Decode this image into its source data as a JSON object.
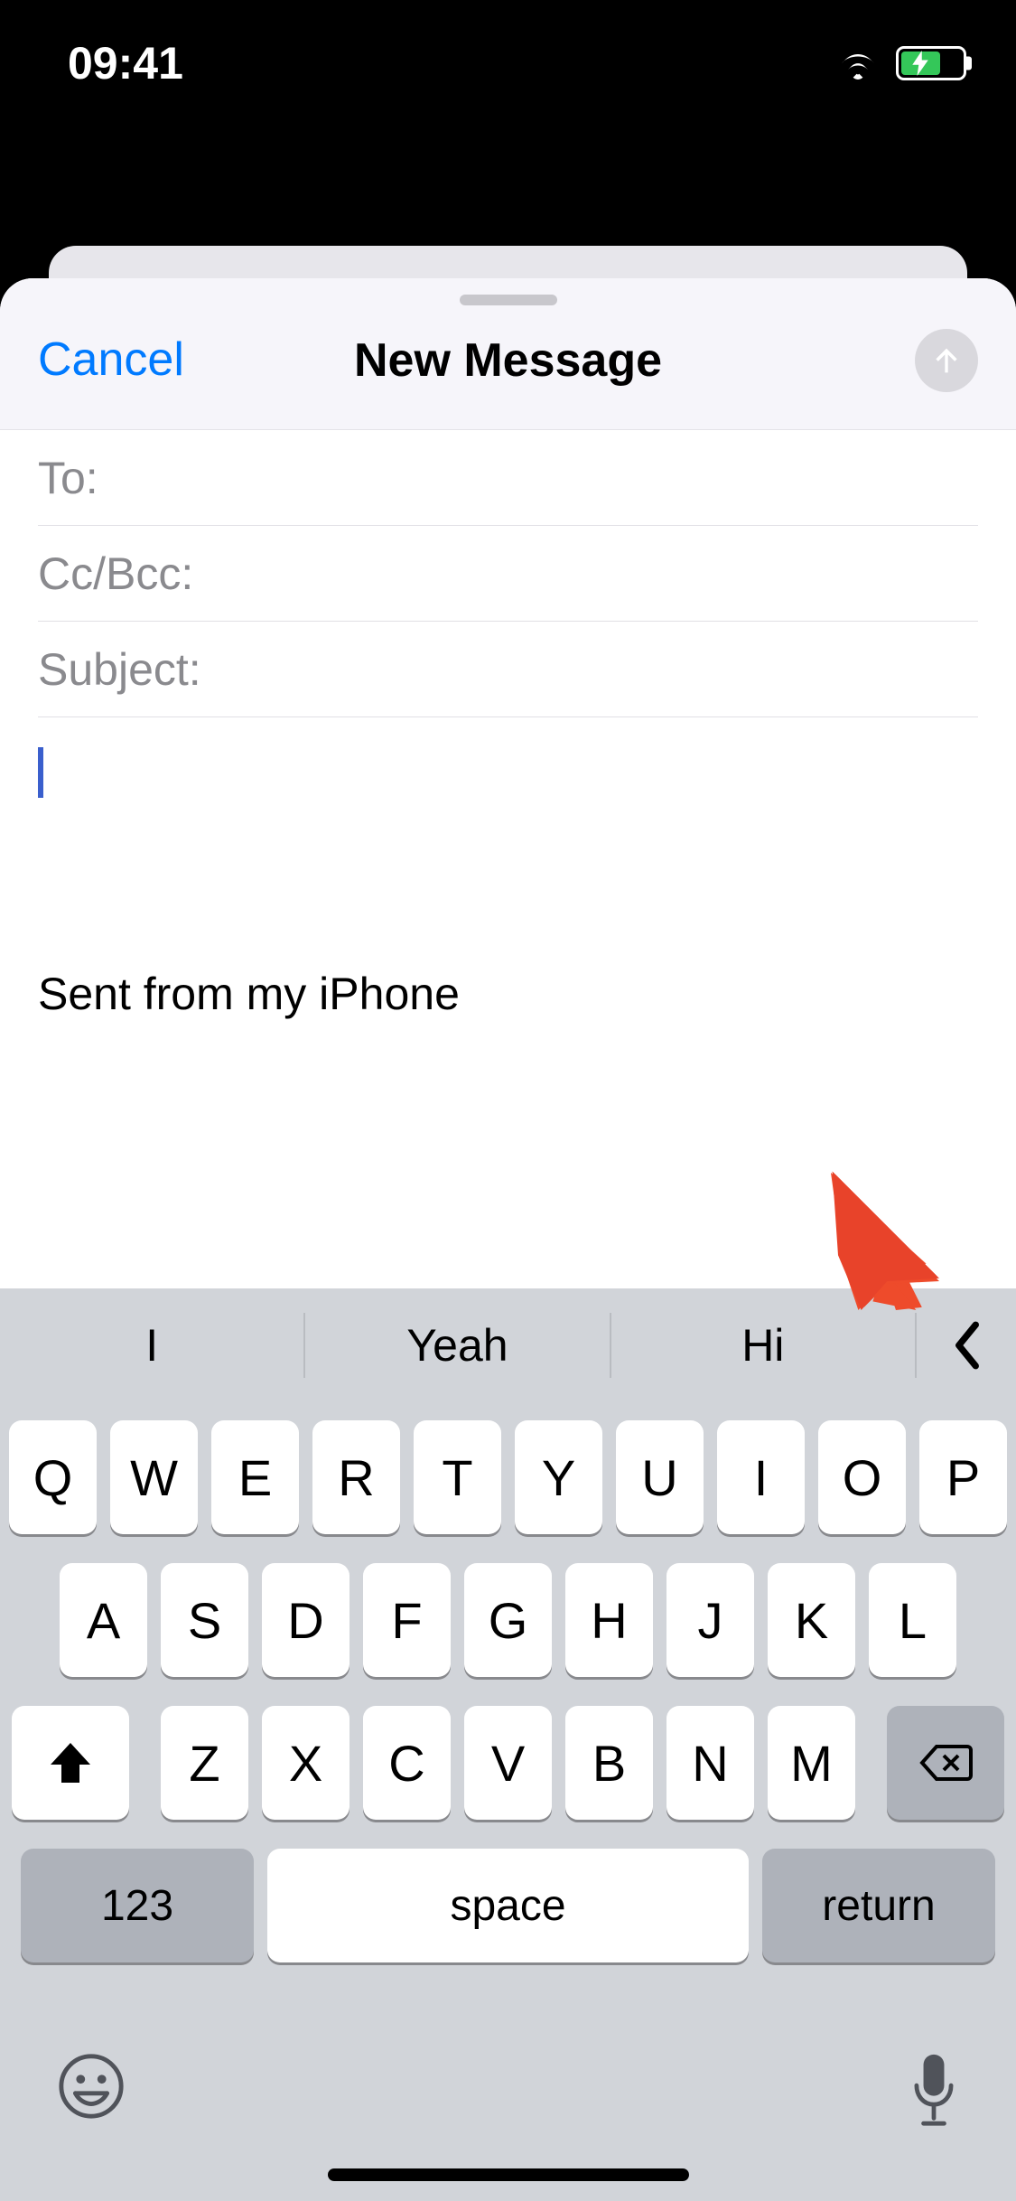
{
  "status": {
    "time": "09:41"
  },
  "header": {
    "cancel": "Cancel",
    "title": "New Message"
  },
  "fields": {
    "to": "To:",
    "ccbcc": "Cc/Bcc:",
    "subject": "Subject:"
  },
  "body": {
    "signature": "Sent from my iPhone"
  },
  "predictive": {
    "s1": "I",
    "s2": "Yeah",
    "s3": "Hi"
  },
  "keys": {
    "r1": [
      "Q",
      "W",
      "E",
      "R",
      "T",
      "Y",
      "U",
      "I",
      "O",
      "P"
    ],
    "r2": [
      "A",
      "S",
      "D",
      "F",
      "G",
      "H",
      "J",
      "K",
      "L"
    ],
    "r3": [
      "Z",
      "X",
      "C",
      "V",
      "B",
      "N",
      "M"
    ],
    "numbers": "123",
    "space": "space",
    "return": "return"
  }
}
